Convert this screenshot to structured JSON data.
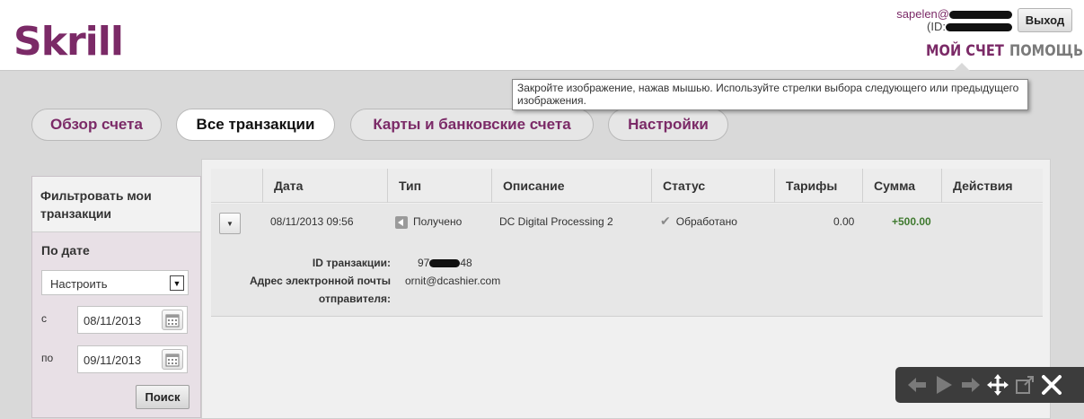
{
  "header": {
    "logo": "Skrill",
    "user_email": "sapelen@",
    "user_id_label": "(ID:",
    "logout_label": "Выход",
    "nav": [
      {
        "label": "МОЙ СЧЕТ",
        "active": true
      },
      {
        "label": "ПОМОЩЬ",
        "active": false
      }
    ]
  },
  "tooltip": {
    "text": "Закройте изображение, нажав мышью. Используйте стрелки выбора следующего или предыдущего изображения."
  },
  "tabs": [
    {
      "label": "Обзор счета",
      "active": false
    },
    {
      "label": "Все транзакции",
      "active": true
    },
    {
      "label": "Карты и банковские счета",
      "active": false
    },
    {
      "label": "Настройки",
      "active": false
    }
  ],
  "sidebar": {
    "title": "Фильтровать мои транзакции",
    "by_date_label": "По дате",
    "period_select": "Настроить",
    "from_label": "с",
    "from_value": "08/11/2013",
    "to_label": "по",
    "to_value": "09/11/2013",
    "search_button": "Поиск"
  },
  "table": {
    "headers": [
      "Дата",
      "Тип",
      "Описание",
      "Статус",
      "Тарифы",
      "Сумма",
      "Действия"
    ],
    "rows": [
      {
        "date": "08/11/2013 09:56",
        "type": "Получено",
        "description": "DC Digital Processing 2",
        "status": "Обработано",
        "fee": "0.00",
        "amount": "+500.00",
        "details": {
          "tx_id_label": "ID транзакции:",
          "tx_id_prefix": "97",
          "tx_id_suffix": "48",
          "sender_email_label_1": "Адрес электронной почты",
          "sender_email_label_2": "отправителя:",
          "sender_email": "ornit@dcashier.com"
        }
      }
    ]
  },
  "colors": {
    "brand": "#7b2a67",
    "amount_positive": "#3f7a2f"
  },
  "viewer_controls": [
    "arrow-left-icon",
    "play-icon",
    "arrow-right-icon",
    "move-icon",
    "external-link-icon",
    "close-icon"
  ]
}
